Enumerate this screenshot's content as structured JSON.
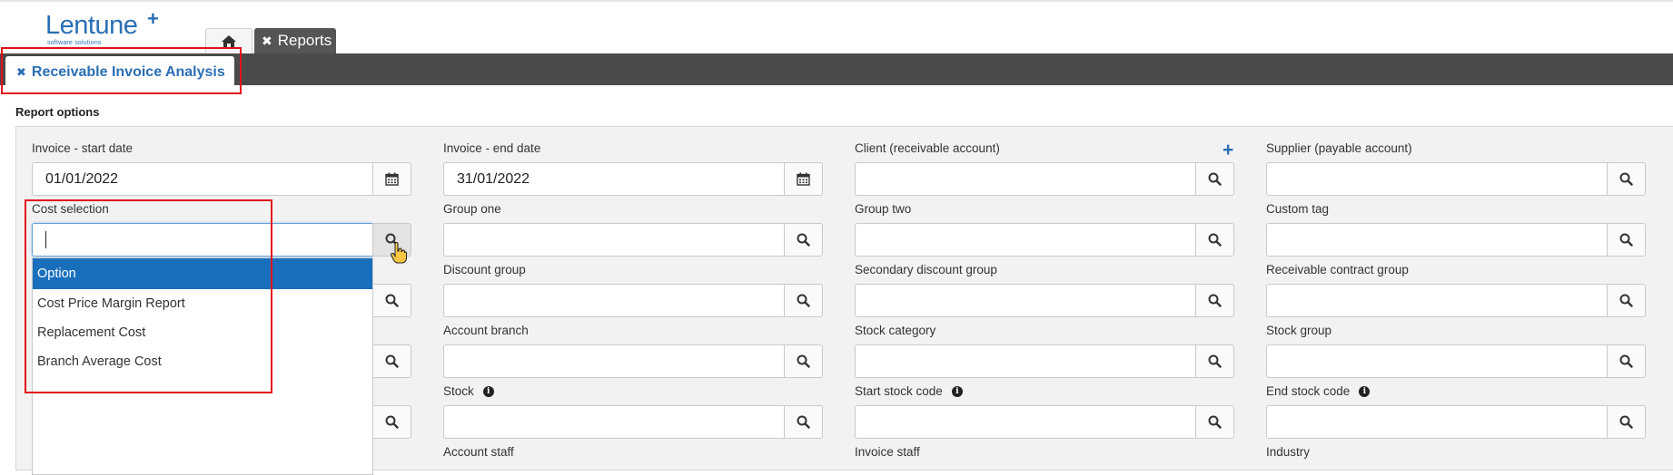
{
  "logo": {
    "name": "Lentune",
    "tagline": "software solutions"
  },
  "tabs": {
    "reports_label": "Reports"
  },
  "sub_tab": {
    "label": "Receivable Invoice Analysis"
  },
  "section": {
    "title": "Report options"
  },
  "fields": {
    "invoice_start_label": "Invoice - start date",
    "invoice_start_value": "01/01/2022",
    "invoice_end_label": "Invoice - end date",
    "invoice_end_value": "31/01/2022",
    "client_label": "Client (receivable account)",
    "supplier_label": "Supplier (payable account)",
    "cost_selection_label": "Cost selection",
    "group_one_label": "Group one",
    "group_two_label": "Group two",
    "custom_tag_label": "Custom tag",
    "discount_group_label": "Discount group",
    "secondary_discount_group_label": "Secondary discount group",
    "receivable_contract_group_label": "Receivable contract group",
    "account_branch_label": "Account branch",
    "stock_category_label": "Stock category",
    "stock_group_label": "Stock group",
    "stock_label": "Stock",
    "start_stock_code_label": "Start stock code",
    "end_stock_code_label": "End stock code",
    "account_staff_label": "Account staff",
    "invoice_staff_label": "Invoice staff",
    "industry_label": "Industry"
  },
  "dropdown": {
    "options": [
      "Option",
      "Cost Price Margin Report",
      "Replacement Cost",
      "Branch Average Cost"
    ]
  },
  "colors": {
    "accent": "#2a6eb5",
    "selected": "#1a6fbd",
    "highlight": "#e0131b",
    "bar": "#4a4a4a"
  }
}
